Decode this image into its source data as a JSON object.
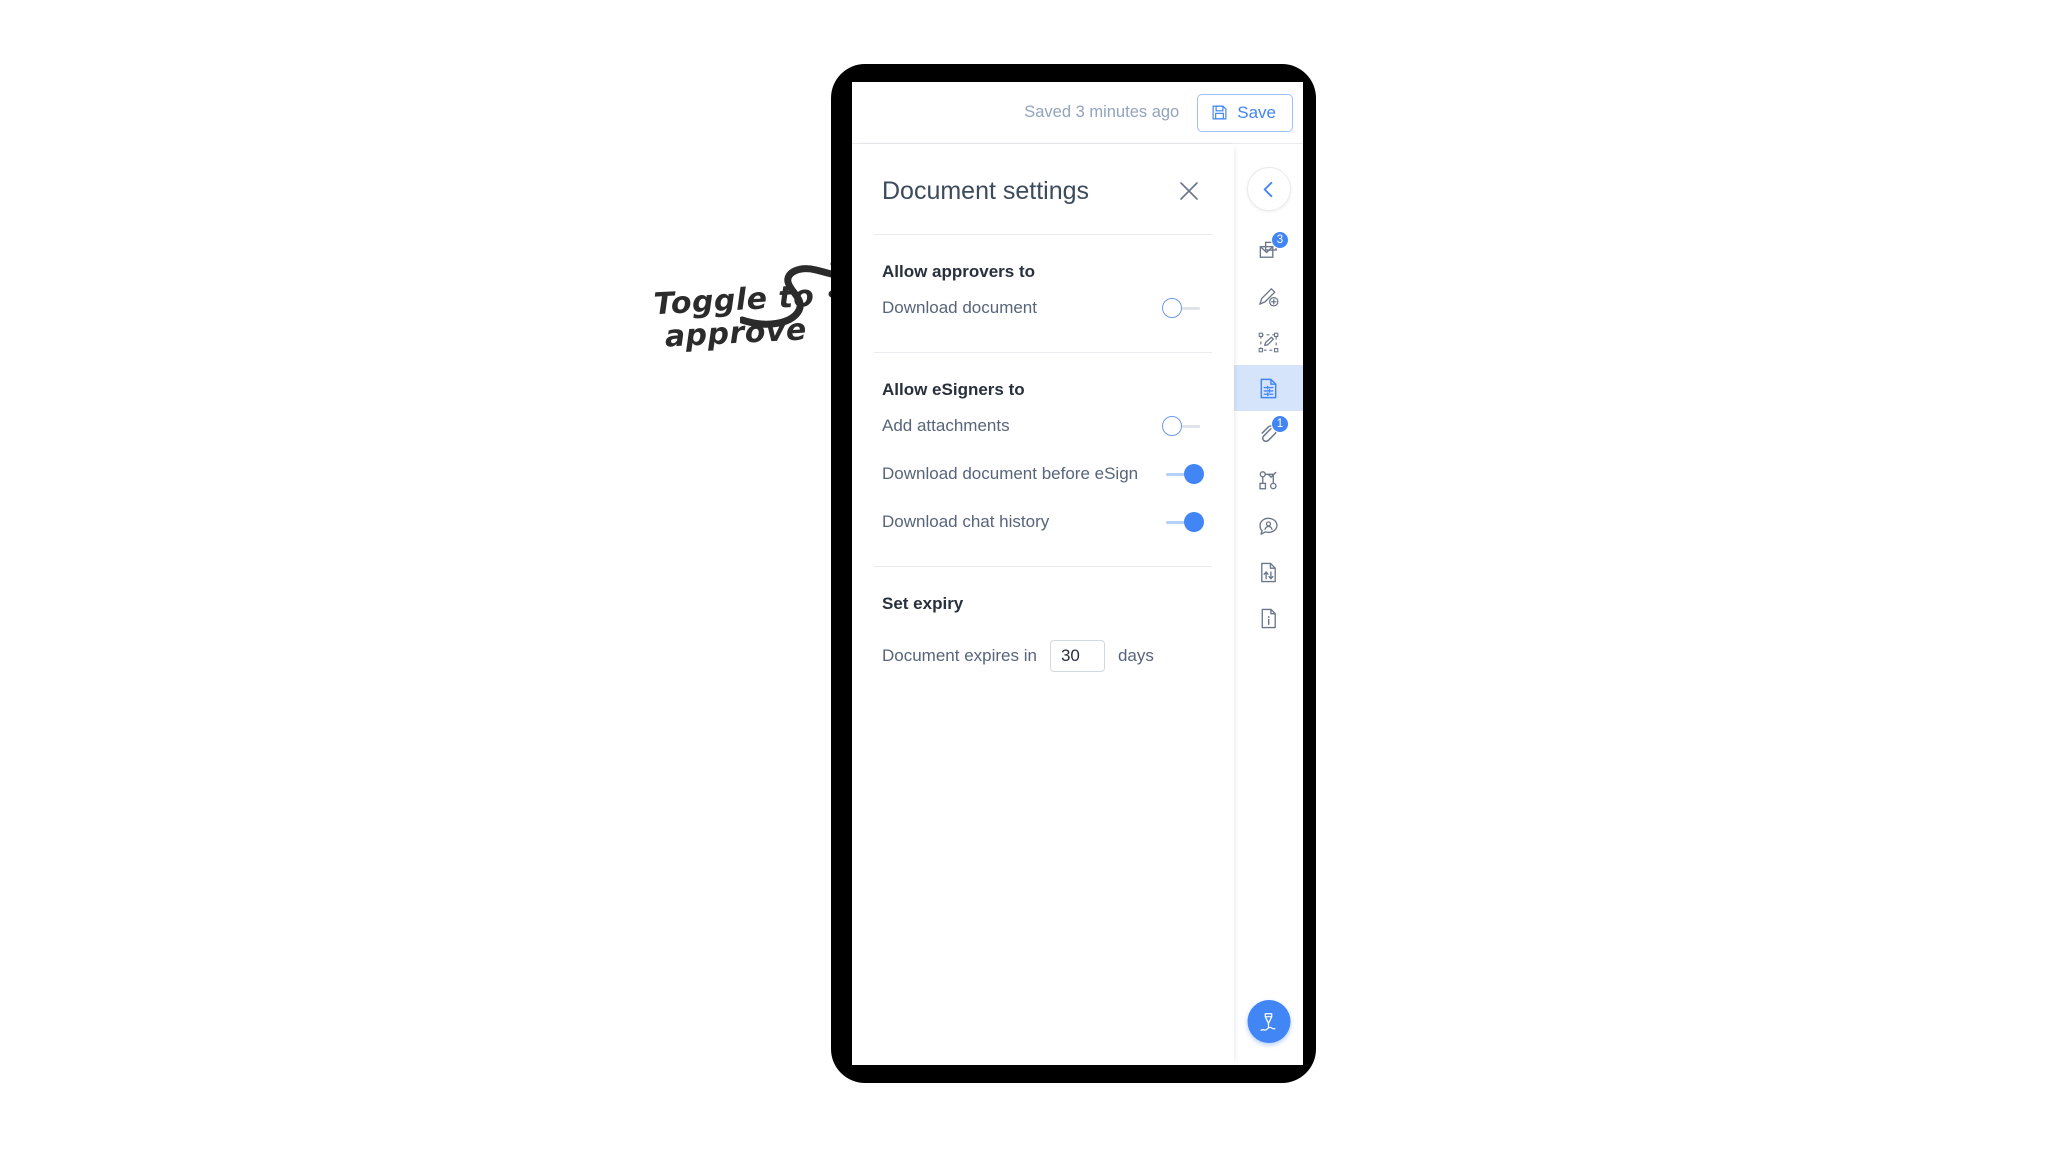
{
  "annotation": {
    "text_line1": "Toggle to",
    "text_line2": "approve",
    "arrow_icon": "curved-arrow-right"
  },
  "topbar": {
    "saved_status": "Saved 3 minutes ago",
    "save_label": "Save",
    "save_icon": "floppy-disk-icon"
  },
  "panel": {
    "title": "Document settings",
    "close_icon": "close-icon",
    "sections": [
      {
        "title": "Allow approvers to",
        "rows": [
          {
            "label": "Download document",
            "state": "off"
          }
        ]
      },
      {
        "title": "Allow eSigners to",
        "rows": [
          {
            "label": "Add attachments",
            "state": "off"
          },
          {
            "label": "Download document before eSign",
            "state": "on"
          },
          {
            "label": "Download chat history",
            "state": "on"
          }
        ]
      }
    ],
    "expiry": {
      "title": "Set expiry",
      "prefix": "Document expires in",
      "value": "30",
      "placeholder": "30",
      "suffix": "days"
    }
  },
  "rail": {
    "back_icon": "chevron-left-icon",
    "items": [
      {
        "name": "inbox-icon",
        "badge": "3",
        "active": false
      },
      {
        "name": "signature-add-icon",
        "badge": "",
        "active": false
      },
      {
        "name": "place-field-icon",
        "badge": "",
        "active": false
      },
      {
        "name": "document-settings-icon",
        "badge": "",
        "active": true
      },
      {
        "name": "attachment-icon",
        "badge": "1",
        "active": false
      },
      {
        "name": "approval-workflow-icon",
        "badge": "",
        "active": false
      },
      {
        "name": "chat-participant-icon",
        "badge": "",
        "active": false
      },
      {
        "name": "document-versions-icon",
        "badge": "",
        "active": false
      },
      {
        "name": "document-info-icon",
        "badge": "",
        "active": false
      }
    ],
    "fab_icon": "sign-pen-icon"
  },
  "colors": {
    "accent": "#4285f4",
    "active_bg": "#d6e4fb",
    "label_text": "#57647a",
    "heading_text": "#28303c",
    "muted_text": "#93a3bd",
    "divider": "#e8eaee"
  }
}
